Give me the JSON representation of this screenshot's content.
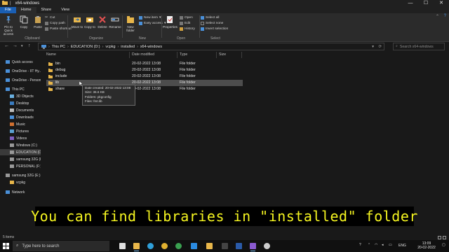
{
  "window": {
    "title": "x64-windows",
    "controls": {
      "minimize": "—",
      "maximize": "☐",
      "close": "✕"
    }
  },
  "ribbon_tabs": [
    "File",
    "Home",
    "Share",
    "View"
  ],
  "ribbon": {
    "clipboard": {
      "pin": "Pin to Quick access",
      "copy": "Copy",
      "paste": "Paste",
      "cut": "Cut",
      "copy_path": "Copy path",
      "paste_shortcut": "Paste shortcut",
      "label": "Clipboard"
    },
    "organize": {
      "move_to": "Move to",
      "copy_to": "Copy to",
      "delete": "Delete",
      "rename": "Rename",
      "label": "Organize"
    },
    "new": {
      "new_folder": "New folder",
      "new_item": "New item",
      "easy_access": "Easy access",
      "label": "New"
    },
    "open": {
      "properties": "Properties",
      "open": "Open",
      "edit": "Edit",
      "history": "History",
      "label": "Open"
    },
    "select": {
      "select_all": "Select all",
      "select_none": "Select none",
      "invert": "Invert selection",
      "label": "Select"
    }
  },
  "address": {
    "crumbs": [
      "This PC",
      "EDUCATION (D:)",
      "vcpkg",
      "installed",
      "x64-windows"
    ],
    "search_placeholder": "Search x64-windows"
  },
  "sidebar": [
    {
      "label": "Quick access",
      "icon": "star-icon"
    },
    {
      "label": "OneDrive - IIT Hy...",
      "icon": "cloud-icon"
    },
    {
      "label": "OneDrive - Person...",
      "icon": "cloud-icon"
    },
    {
      "label": "This PC",
      "icon": "computer-icon"
    },
    {
      "label": "3D Objects",
      "icon": "cube-icon"
    },
    {
      "label": "Desktop",
      "icon": "desktop-icon"
    },
    {
      "label": "Documents",
      "icon": "document-icon"
    },
    {
      "label": "Downloads",
      "icon": "download-icon"
    },
    {
      "label": "Music",
      "icon": "music-icon"
    },
    {
      "label": "Pictures",
      "icon": "picture-icon"
    },
    {
      "label": "Videos",
      "icon": "video-icon"
    },
    {
      "label": "Windows (C:)",
      "icon": "drive-icon"
    },
    {
      "label": "EDUCATION (D:)",
      "icon": "drive-icon",
      "selected": true
    },
    {
      "label": "samsung 32G (E:)",
      "icon": "drive-icon"
    },
    {
      "label": "PERSONAL (F:)",
      "icon": "drive-icon"
    },
    {
      "label": "samsung 32G (E:)",
      "icon": "usb-drive-icon"
    },
    {
      "label": "vcpkg",
      "icon": "folder-icon"
    },
    {
      "label": "Network",
      "icon": "network-icon"
    }
  ],
  "columns": [
    "Name",
    "Date modified",
    "Type",
    "Size"
  ],
  "files": [
    {
      "name": "bin",
      "date": "20-02-2022 13:08",
      "type": "File folder"
    },
    {
      "name": "debug",
      "date": "20-02-2022 13:08",
      "type": "File folder"
    },
    {
      "name": "include",
      "date": "20-02-2022 13:08",
      "type": "File folder"
    },
    {
      "name": "lib",
      "date": "20-02-2022 13:08",
      "type": "File folder",
      "hover": true
    },
    {
      "name": "share",
      "date": "20-02-2022 13:08",
      "type": "File folder"
    }
  ],
  "tooltip": {
    "created": "Date created: 20-02-2022 13:08",
    "size": "Size: 36.6 KB",
    "folders": "Folders: pkgconfig",
    "files": "Files: fmt.lib"
  },
  "caption": "You can find libraries in \"installed\" folder",
  "status": {
    "items": "5 items"
  },
  "taskbar": {
    "search_placeholder": "Type here to search",
    "lang": "ENG",
    "time": "13:09",
    "date": "20-02-2022",
    "apps": [
      "task-view-icon",
      "file-explorer-icon",
      "edge-icon",
      "chrome-icon",
      "chrome-alt-icon",
      "vscode-icon",
      "folder-app-icon",
      "terminal-icon",
      "word-icon",
      "visual-studio-icon",
      "obs-icon"
    ]
  }
}
